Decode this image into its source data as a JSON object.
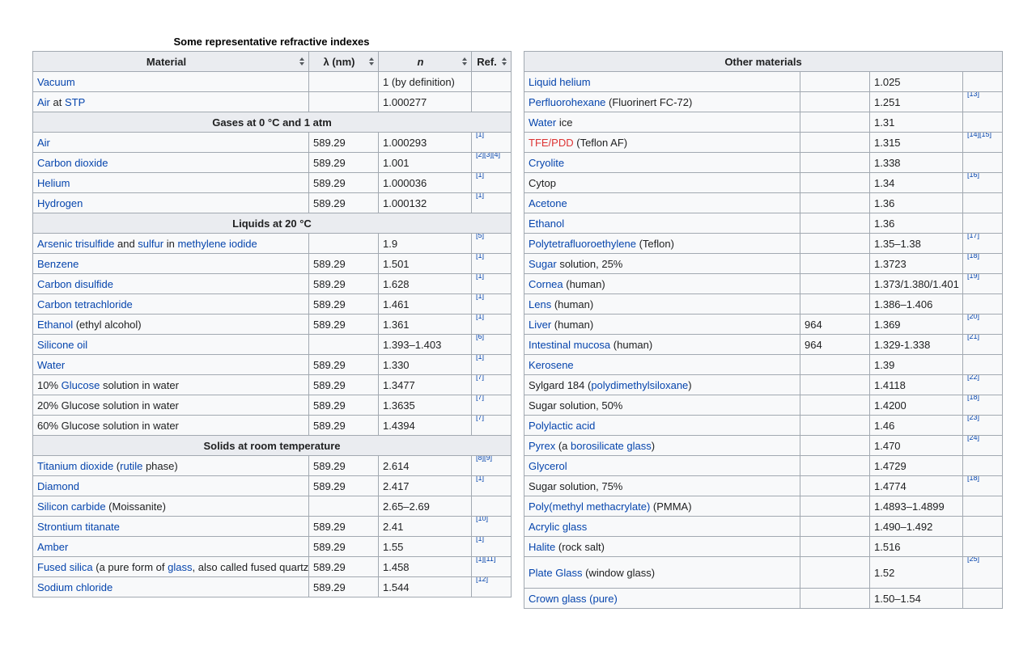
{
  "caption": "Some representative refractive indexes",
  "left_table": {
    "headers": [
      "Material",
      "λ (nm)",
      "n",
      "Ref."
    ],
    "rows": [
      {
        "type": "row",
        "material": [
          {
            "t": "Vacuum",
            "link": true
          }
        ],
        "lambda": "",
        "n": "1 (by definition)",
        "ref": ""
      },
      {
        "type": "row",
        "material": [
          {
            "t": "Air",
            "link": true
          },
          {
            "t": " at "
          },
          {
            "t": "STP",
            "link": true
          }
        ],
        "lambda": "",
        "n": "1.000277",
        "ref": ""
      },
      {
        "type": "section",
        "label": "Gases at 0 °C and 1 atm"
      },
      {
        "type": "row",
        "material": [
          {
            "t": "Air",
            "link": true
          }
        ],
        "lambda": "589.29",
        "n": "1.000293",
        "ref": "[1]"
      },
      {
        "type": "row",
        "material": [
          {
            "t": "Carbon dioxide",
            "link": true
          }
        ],
        "lambda": "589.29",
        "n": "1.001",
        "ref": "[2][3][4]"
      },
      {
        "type": "row",
        "material": [
          {
            "t": "Helium",
            "link": true
          }
        ],
        "lambda": "589.29",
        "n": "1.000036",
        "ref": "[1]"
      },
      {
        "type": "row",
        "material": [
          {
            "t": "Hydrogen",
            "link": true
          }
        ],
        "lambda": "589.29",
        "n": "1.000132",
        "ref": "[1]"
      },
      {
        "type": "section",
        "label": "Liquids at 20 °C"
      },
      {
        "type": "row",
        "material": [
          {
            "t": "Arsenic trisulfide",
            "link": true
          },
          {
            "t": " and "
          },
          {
            "t": "sulfur",
            "link": true
          },
          {
            "t": " in "
          },
          {
            "t": "methylene iodide",
            "link": true
          }
        ],
        "lambda": "",
        "n": "1.9",
        "ref": "[5]"
      },
      {
        "type": "row",
        "material": [
          {
            "t": "Benzene",
            "link": true
          }
        ],
        "lambda": "589.29",
        "n": "1.501",
        "ref": "[1]"
      },
      {
        "type": "row",
        "material": [
          {
            "t": "Carbon disulfide",
            "link": true
          }
        ],
        "lambda": "589.29",
        "n": "1.628",
        "ref": "[1]"
      },
      {
        "type": "row",
        "material": [
          {
            "t": "Carbon tetrachloride",
            "link": true
          }
        ],
        "lambda": "589.29",
        "n": "1.461",
        "ref": "[1]"
      },
      {
        "type": "row",
        "material": [
          {
            "t": "Ethanol",
            "link": true
          },
          {
            "t": " (ethyl alcohol)"
          }
        ],
        "lambda": "589.29",
        "n": "1.361",
        "ref": "[1]"
      },
      {
        "type": "row",
        "material": [
          {
            "t": "Silicone oil",
            "link": true
          }
        ],
        "lambda": "",
        "n": "1.393–1.403",
        "ref": "[6]"
      },
      {
        "type": "row",
        "material": [
          {
            "t": "Water",
            "link": true
          }
        ],
        "lambda": "589.29",
        "n": "1.330",
        "ref": "[1]"
      },
      {
        "type": "row",
        "material": [
          {
            "t": "10% "
          },
          {
            "t": "Glucose",
            "link": true
          },
          {
            "t": " solution in water"
          }
        ],
        "lambda": "589.29",
        "n": "1.3477",
        "ref": "[7]"
      },
      {
        "type": "row",
        "material": [
          {
            "t": "20% Glucose solution in water"
          }
        ],
        "lambda": "589.29",
        "n": "1.3635",
        "ref": "[7]"
      },
      {
        "type": "row",
        "material": [
          {
            "t": "60% Glucose solution in water"
          }
        ],
        "lambda": "589.29",
        "n": "1.4394",
        "ref": "[7]"
      },
      {
        "type": "section",
        "label": "Solids at room temperature"
      },
      {
        "type": "row",
        "material": [
          {
            "t": "Titanium dioxide",
            "link": true
          },
          {
            "t": " ("
          },
          {
            "t": "rutile",
            "link": true
          },
          {
            "t": " phase)"
          }
        ],
        "lambda": "589.29",
        "n": "2.614",
        "ref": "[8][9]"
      },
      {
        "type": "row",
        "material": [
          {
            "t": "Diamond",
            "link": true
          }
        ],
        "lambda": "589.29",
        "n": "2.417",
        "ref": "[1]"
      },
      {
        "type": "row",
        "material": [
          {
            "t": "Silicon carbide",
            "link": true
          },
          {
            "t": " (Moissanite)"
          }
        ],
        "lambda": "",
        "n": "2.65–2.69",
        "ref": ""
      },
      {
        "type": "row",
        "material": [
          {
            "t": "Strontium titanate",
            "link": true
          }
        ],
        "lambda": "589.29",
        "n": "2.41",
        "ref": "[10]"
      },
      {
        "type": "row",
        "material": [
          {
            "t": "Amber",
            "link": true
          }
        ],
        "lambda": "589.29",
        "n": "1.55",
        "ref": "[1]"
      },
      {
        "type": "row",
        "material": [
          {
            "t": "Fused silica",
            "link": true
          },
          {
            "t": " (a pure form of "
          },
          {
            "t": "glass",
            "link": true
          },
          {
            "t": ", also called fused quartz)"
          }
        ],
        "lambda": "589.29",
        "n": "1.458",
        "ref": "[1][11]"
      },
      {
        "type": "row",
        "material": [
          {
            "t": "Sodium chloride",
            "link": true
          }
        ],
        "lambda": "589.29",
        "n": "1.544",
        "ref": "[12]"
      }
    ]
  },
  "right_table": {
    "header": "Other materials",
    "rows": [
      {
        "material": [
          {
            "t": "Liquid helium",
            "link": true
          }
        ],
        "lambda": "",
        "n": "1.025",
        "ref": ""
      },
      {
        "material": [
          {
            "t": "Perfluorohexane",
            "link": true
          },
          {
            "t": " (Fluorinert FC-72)"
          }
        ],
        "lambda": "",
        "n": "1.251",
        "ref": "[13]"
      },
      {
        "material": [
          {
            "t": "Water",
            "link": true
          },
          {
            "t": " ice"
          }
        ],
        "lambda": "",
        "n": "1.31",
        "ref": ""
      },
      {
        "material": [
          {
            "t": "TFE/PDD",
            "link": true,
            "red": true
          },
          {
            "t": " (Teflon AF)"
          }
        ],
        "lambda": "",
        "n": "1.315",
        "ref": "[14][15]"
      },
      {
        "material": [
          {
            "t": "Cryolite",
            "link": true
          }
        ],
        "lambda": "",
        "n": "1.338",
        "ref": ""
      },
      {
        "material": [
          {
            "t": "Cytop"
          }
        ],
        "lambda": "",
        "n": "1.34",
        "ref": "[16]"
      },
      {
        "material": [
          {
            "t": "Acetone",
            "link": true
          }
        ],
        "lambda": "",
        "n": "1.36",
        "ref": ""
      },
      {
        "material": [
          {
            "t": "Ethanol",
            "link": true
          }
        ],
        "lambda": "",
        "n": "1.36",
        "ref": ""
      },
      {
        "material": [
          {
            "t": "Polytetrafluoroethylene",
            "link": true
          },
          {
            "t": " (Teflon)"
          }
        ],
        "lambda": "",
        "n": "1.35–1.38",
        "ref": "[17]"
      },
      {
        "material": [
          {
            "t": "Sugar",
            "link": true
          },
          {
            "t": " solution, 25%"
          }
        ],
        "lambda": "",
        "n": "1.3723",
        "ref": "[18]"
      },
      {
        "material": [
          {
            "t": "Cornea",
            "link": true
          },
          {
            "t": " (human)"
          }
        ],
        "lambda": "",
        "n": "1.373/1.380/1.401",
        "ref": "[19]"
      },
      {
        "material": [
          {
            "t": "Lens",
            "link": true
          },
          {
            "t": " (human)"
          }
        ],
        "lambda": "",
        "n": "1.386–1.406",
        "ref": ""
      },
      {
        "material": [
          {
            "t": "Liver",
            "link": true
          },
          {
            "t": " (human)"
          }
        ],
        "lambda": "964",
        "n": "1.369",
        "ref": "[20]"
      },
      {
        "material": [
          {
            "t": "Intestinal mucosa",
            "link": true
          },
          {
            "t": " (human)"
          }
        ],
        "lambda": "964",
        "n": "1.329-1.338",
        "ref": "[21]"
      },
      {
        "material": [
          {
            "t": "Kerosene",
            "link": true
          }
        ],
        "lambda": "",
        "n": "1.39",
        "ref": ""
      },
      {
        "material": [
          {
            "t": "Sylgard 184 ("
          },
          {
            "t": "polydimethylsiloxane",
            "link": true
          },
          {
            "t": ")"
          }
        ],
        "lambda": "",
        "n": "1.4118",
        "ref": "[22]"
      },
      {
        "material": [
          {
            "t": "Sugar solution, 50%"
          }
        ],
        "lambda": "",
        "n": "1.4200",
        "ref": "[18]"
      },
      {
        "material": [
          {
            "t": "Polylactic acid",
            "link": true
          }
        ],
        "lambda": "",
        "n": "1.46",
        "ref": "[23]"
      },
      {
        "material": [
          {
            "t": "Pyrex",
            "link": true
          },
          {
            "t": " (a "
          },
          {
            "t": "borosilicate glass",
            "link": true
          },
          {
            "t": ")"
          }
        ],
        "lambda": "",
        "n": "1.470",
        "ref": "[24]"
      },
      {
        "material": [
          {
            "t": "Glycerol",
            "link": true
          }
        ],
        "lambda": "",
        "n": "1.4729",
        "ref": ""
      },
      {
        "material": [
          {
            "t": "Sugar solution, 75%"
          }
        ],
        "lambda": "",
        "n": "1.4774",
        "ref": "[18]"
      },
      {
        "material": [
          {
            "t": "Poly(methyl methacrylate)",
            "link": true
          },
          {
            "t": " (PMMA)"
          }
        ],
        "lambda": "",
        "n": "1.4893–1.4899",
        "ref": ""
      },
      {
        "material": [
          {
            "t": "Acrylic glass",
            "link": true
          }
        ],
        "lambda": "",
        "n": "1.490–1.492",
        "ref": ""
      },
      {
        "material": [
          {
            "t": "Halite",
            "link": true
          },
          {
            "t": " (rock salt)"
          }
        ],
        "lambda": "",
        "n": "1.516",
        "ref": ""
      },
      {
        "material": [
          {
            "t": "Plate Glass",
            "link": true
          },
          {
            "t": " (window glass)"
          }
        ],
        "lambda": "",
        "n": "1.52",
        "ref": "[25]",
        "tall": true
      },
      {
        "material": [
          {
            "t": "Crown glass (pure)",
            "link": true
          }
        ],
        "lambda": "",
        "n": "1.50–1.54",
        "ref": ""
      }
    ]
  }
}
